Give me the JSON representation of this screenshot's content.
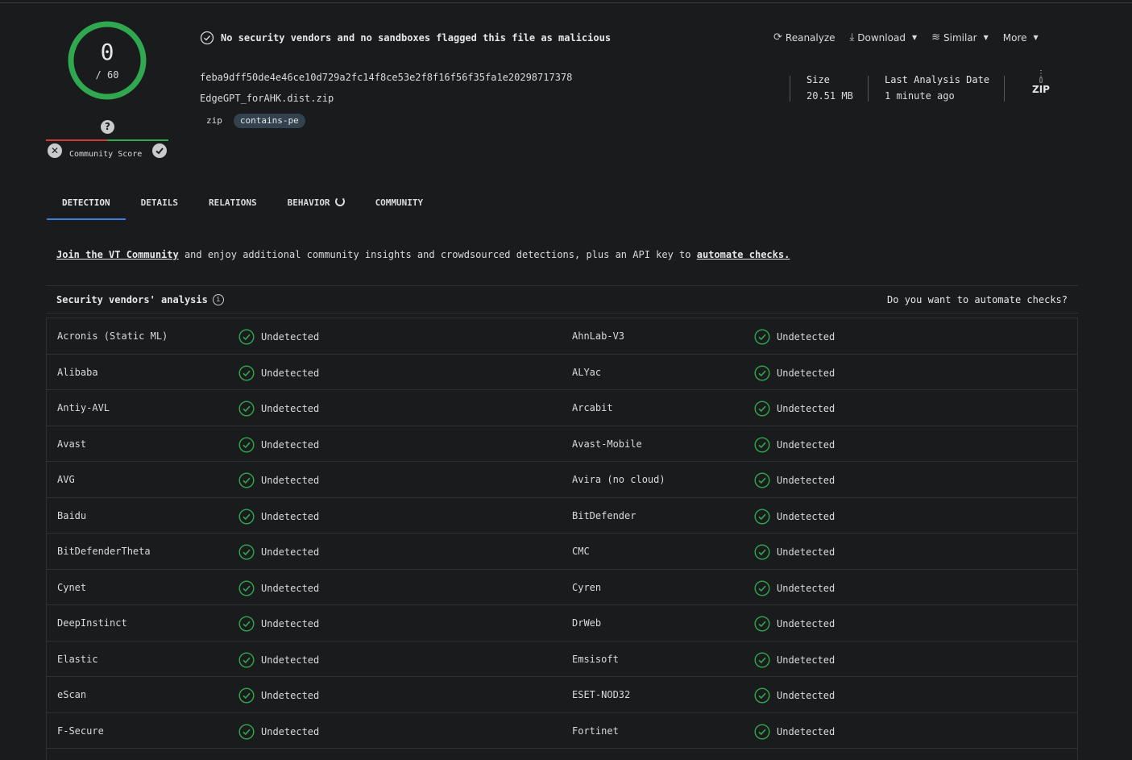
{
  "score": {
    "detected": "0",
    "total": "/ 60"
  },
  "community": {
    "label": "Community Score",
    "question": "?"
  },
  "verdict": "No security vendors and no sandboxes flagged this file as malicious",
  "file": {
    "hash": "feba9dff50de4e46ce10d729a2fc14f8ce53e2f8f16f56f35fa1e20298717378",
    "name": "EdgeGPT_forAHK.dist.zip",
    "tags": [
      "zip",
      "contains-pe"
    ],
    "size_label": "Size",
    "size_value": "20.51 MB",
    "date_label": "Last Analysis Date",
    "date_value": "1 minute ago",
    "type_icon_text": "ZIP"
  },
  "actions": {
    "reanalyze": "Reanalyze",
    "download": "Download",
    "similar": "Similar",
    "more": "More"
  },
  "tabs": [
    "DETECTION",
    "DETAILS",
    "RELATIONS",
    "BEHAVIOR",
    "COMMUNITY"
  ],
  "banner": {
    "link1": "Join the VT Community",
    "middle": " and enjoy additional community insights and crowdsourced detections, plus an API key to ",
    "link2": "automate checks."
  },
  "analysis": {
    "title": "Security vendors' analysis",
    "automate": "Do you want to automate checks?",
    "status": "Undetected",
    "rows": [
      [
        "Acronis (Static ML)",
        "AhnLab-V3"
      ],
      [
        "Alibaba",
        "ALYac"
      ],
      [
        "Antiy-AVL",
        "Arcabit"
      ],
      [
        "Avast",
        "Avast-Mobile"
      ],
      [
        "AVG",
        "Avira (no cloud)"
      ],
      [
        "Baidu",
        "BitDefender"
      ],
      [
        "BitDefenderTheta",
        "CMC"
      ],
      [
        "Cynet",
        "Cyren"
      ],
      [
        "DeepInstinct",
        "DrWeb"
      ],
      [
        "Elastic",
        "Emsisoft"
      ],
      [
        "eScan",
        "ESET-NOD32"
      ],
      [
        "F-Secure",
        "Fortinet"
      ]
    ]
  },
  "colors": {
    "accent": "#3f7de0",
    "ok": "#2fa84f",
    "bg": "#1a1b1d"
  }
}
